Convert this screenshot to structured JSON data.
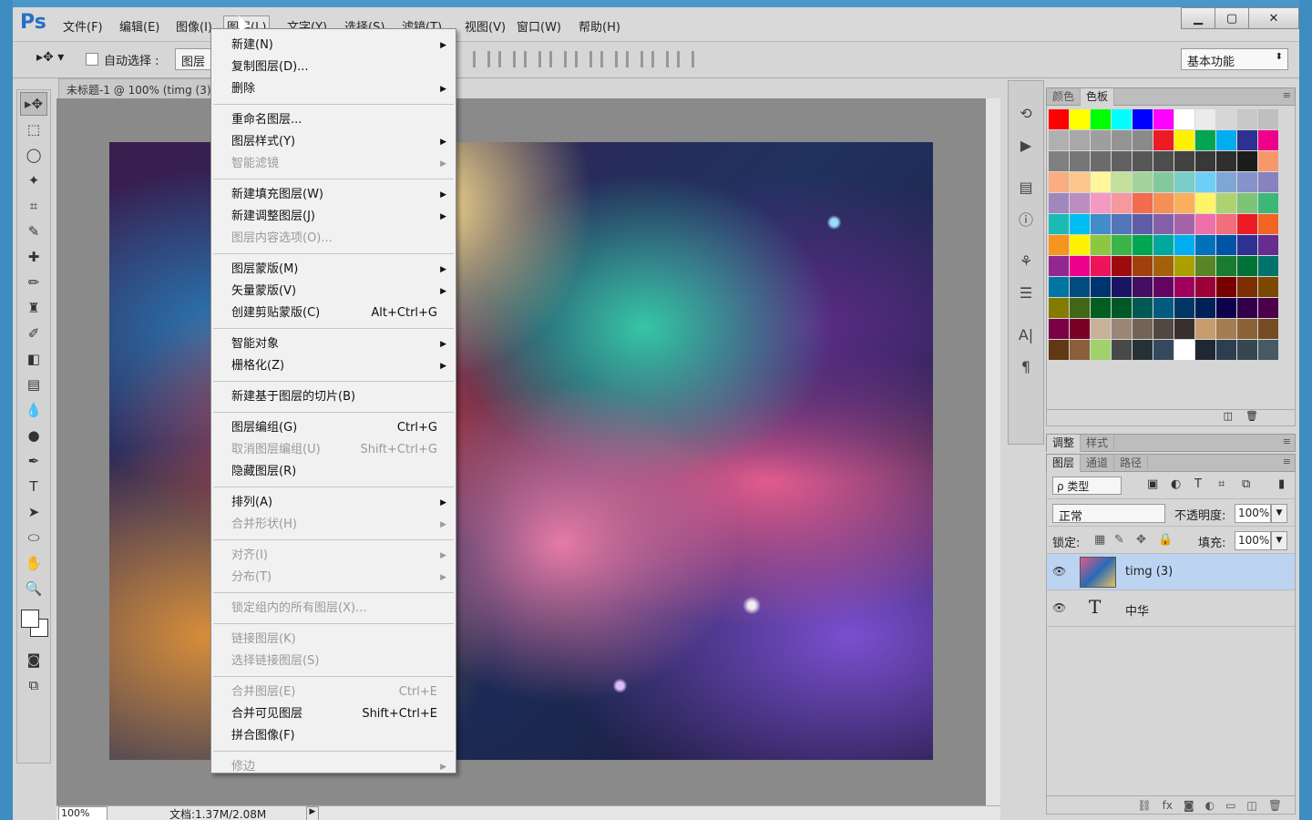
{
  "app": {
    "logo": "Ps"
  },
  "menubar": [
    "文件(F)",
    "编辑(E)",
    "图像(I)",
    "图层(L)",
    "文字(Y)",
    "选择(S)",
    "滤镜(T)",
    "视图(V)",
    "窗口(W)",
    "帮助(H)"
  ],
  "window_buttons": {
    "minimize": "▁",
    "maximize": "▢",
    "close": "✕"
  },
  "options": {
    "auto_select_label": "自动选择 :",
    "auto_select_target": "图层",
    "workspace": "基本功能"
  },
  "document": {
    "tab_title": "未标题-1 @ 100% (timg (3),",
    "zoom": "100%",
    "doc_info": "文档:1.37M/2.08M"
  },
  "layer_menu": [
    {
      "label": "新建(N)",
      "submenu": true
    },
    {
      "label": "复制图层(D)..."
    },
    {
      "label": "删除",
      "submenu": true
    },
    {
      "sep": true
    },
    {
      "label": "重命名图层..."
    },
    {
      "label": "图层样式(Y)",
      "submenu": true
    },
    {
      "label": "智能滤镜",
      "submenu": true,
      "disabled": true
    },
    {
      "sep": true
    },
    {
      "label": "新建填充图层(W)",
      "submenu": true
    },
    {
      "label": "新建调整图层(J)",
      "submenu": true
    },
    {
      "label": "图层内容选项(O)...",
      "disabled": true
    },
    {
      "sep": true
    },
    {
      "label": "图层蒙版(M)",
      "submenu": true
    },
    {
      "label": "矢量蒙版(V)",
      "submenu": true
    },
    {
      "label": "创建剪贴蒙版(C)",
      "shortcut": "Alt+Ctrl+G"
    },
    {
      "sep": true
    },
    {
      "label": "智能对象",
      "submenu": true
    },
    {
      "label": "栅格化(Z)",
      "submenu": true
    },
    {
      "sep": true
    },
    {
      "label": "新建基于图层的切片(B)"
    },
    {
      "sep": true
    },
    {
      "label": "图层编组(G)",
      "shortcut": "Ctrl+G"
    },
    {
      "label": "取消图层编组(U)",
      "shortcut": "Shift+Ctrl+G",
      "disabled": true
    },
    {
      "label": "隐藏图层(R)"
    },
    {
      "sep": true
    },
    {
      "label": "排列(A)",
      "submenu": true
    },
    {
      "label": "合并形状(H)",
      "submenu": true,
      "disabled": true
    },
    {
      "sep": true
    },
    {
      "label": "对齐(I)",
      "submenu": true,
      "disabled": true
    },
    {
      "label": "分布(T)",
      "submenu": true,
      "disabled": true
    },
    {
      "sep": true
    },
    {
      "label": "锁定组内的所有图层(X)...",
      "disabled": true
    },
    {
      "sep": true
    },
    {
      "label": "链接图层(K)",
      "disabled": true
    },
    {
      "label": "选择链接图层(S)",
      "disabled": true
    },
    {
      "sep": true
    },
    {
      "label": "合并图层(E)",
      "shortcut": "Ctrl+E",
      "disabled": true
    },
    {
      "label": "合并可见图层",
      "shortcut": "Shift+Ctrl+E"
    },
    {
      "label": "拼合图像(F)"
    },
    {
      "sep": true
    },
    {
      "label": "修边",
      "submenu": true,
      "disabled": true
    }
  ],
  "tools": [
    "move-tool",
    "marquee-tool",
    "lasso-tool",
    "quick-select-tool",
    "crop-tool",
    "eyedropper-tool",
    "healing-brush-tool",
    "brush-tool",
    "stamp-tool",
    "history-brush-tool",
    "eraser-tool",
    "gradient-tool",
    "blur-tool",
    "dodge-tool",
    "pen-tool",
    "type-tool",
    "path-select-tool",
    "ellipse-tool",
    "hand-tool",
    "zoom-tool"
  ],
  "tool_glyphs": [
    "▸✥",
    "⬚",
    "◯",
    "✦",
    "⌗",
    "✎",
    "✚",
    "✏",
    "♜",
    "✐",
    "◧",
    "▤",
    "💧",
    "●",
    "✒",
    "T",
    "➤",
    "⬭",
    "✋",
    "🔍"
  ],
  "swatch_panel": {
    "tabs": [
      "颜色",
      "色板"
    ]
  },
  "swatches": [
    "#ff0000",
    "#ffff00",
    "#00ff00",
    "#00ffff",
    "#0000ff",
    "#ff00ff",
    "#ffffff",
    "#ebebeb",
    "#d6d6d6",
    "#c8c8c8",
    "#bfbfbf",
    "#b0b0b0",
    "#a8a8a8",
    "#9e9e9e",
    "#949494",
    "#8a8a8a",
    "#ed1c24",
    "#fff200",
    "#00a651",
    "#00aeef",
    "#2e3192",
    "#ec008c",
    "#808080",
    "#767676",
    "#6b6b6b",
    "#616161",
    "#575757",
    "#4d4d4d",
    "#424242",
    "#383838",
    "#2e2e2e",
    "#1c1c1c",
    "#f7976a",
    "#f9ad81",
    "#fdc68a",
    "#fff79a",
    "#c4df9b",
    "#a3d39c",
    "#82ca9d",
    "#7bcdc8",
    "#6ecff6",
    "#7ea7d8",
    "#8493ca",
    "#8882be",
    "#a187be",
    "#bc8dbf",
    "#f49ac2",
    "#f6989d",
    "#f26c4f",
    "#f68e55",
    "#fbaf5c",
    "#fff467",
    "#acd372",
    "#7cc576",
    "#3bb878",
    "#1abbb4",
    "#00bff3",
    "#438ccb",
    "#5574b9",
    "#605ca8",
    "#855fa8",
    "#a763a8",
    "#f06eaa",
    "#f26d7d",
    "#ed1c24",
    "#f26522",
    "#f7941d",
    "#fff200",
    "#8dc73f",
    "#39b54a",
    "#00a651",
    "#00a99d",
    "#00aeef",
    "#0072bc",
    "#0054a6",
    "#2e3192",
    "#662d91",
    "#92278f",
    "#ec008c",
    "#ed145b",
    "#9e0b0f",
    "#a0410d",
    "#a3620a",
    "#aba000",
    "#598527",
    "#197b30",
    "#007236",
    "#00746b",
    "#0076a3",
    "#004b80",
    "#003471",
    "#1b1464",
    "#440e62",
    "#630460",
    "#9e005d",
    "#9e0039",
    "#790000",
    "#7b2e00",
    "#7d4900",
    "#827b00",
    "#406618",
    "#005e20",
    "#005826",
    "#005952",
    "#005b7f",
    "#003663",
    "#002157",
    "#0d004c",
    "#32004b",
    "#4b0049",
    "#7b0046",
    "#7a0026",
    "#c7b299",
    "#998675",
    "#736357",
    "#534741",
    "#37302d",
    "#c69c6d",
    "#a67c52",
    "#8c6239",
    "#754c24",
    "#603913",
    "#8b5e3c",
    "#a0d16b",
    "#494949",
    "#263238",
    "#34495e",
    "#ffffff",
    "#1f2733",
    "#2c3e50",
    "#37474f",
    "#455a64"
  ],
  "adjust_panel": {
    "tabs": [
      "调整",
      "样式"
    ]
  },
  "layers_panel": {
    "tabs": [
      "图层",
      "通道",
      "路径"
    ],
    "filter_label": "ρ 类型",
    "blend_mode": "正常",
    "opacity_label": "不透明度:",
    "opacity": "100%",
    "lock_label": "锁定:",
    "fill_label": "填充:",
    "fill": "100%"
  },
  "layers": [
    {
      "name": "timg (3)",
      "type": "image",
      "selected": true
    },
    {
      "name": "中华",
      "type": "text",
      "selected": false
    }
  ]
}
